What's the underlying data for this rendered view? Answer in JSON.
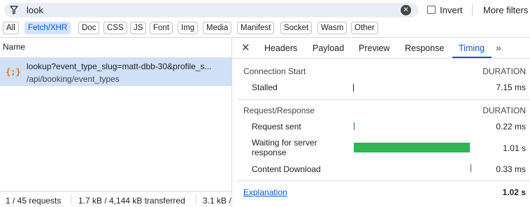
{
  "filter": {
    "query": "look",
    "invert_label": "Invert",
    "more_filters_label": "More filters"
  },
  "type_filters": [
    "All",
    "Fetch/XHR",
    "Doc",
    "CSS",
    "JS",
    "Font",
    "Img",
    "Media",
    "Manifest",
    "Socket",
    "Wasm",
    "Other"
  ],
  "type_filter_active": "Fetch/XHR",
  "requests": {
    "column_name": "Name",
    "items": [
      {
        "name": "lookup?event_type_slug=matt-dbb-30&profile_s...",
        "path": "/api/booking/event_types",
        "icon": "xhr-braces-icon"
      }
    ]
  },
  "status_bar": {
    "requests": "1 / 45 requests",
    "transferred": "1.7 kB / 4,144 kB transferred",
    "resources": "3.1 kB /"
  },
  "detail_tabs": [
    "Headers",
    "Payload",
    "Preview",
    "Response",
    "Timing"
  ],
  "active_tab": "Timing",
  "timing": {
    "connection_start": {
      "heading": "Connection Start",
      "duration_label": "DURATION",
      "rows": [
        {
          "label": "Stalled",
          "value": "7.15 ms",
          "share": 0.007
        }
      ]
    },
    "request_response": {
      "heading": "Request/Response",
      "duration_label": "DURATION",
      "rows": [
        {
          "label": "Request sent",
          "value": "0.22 ms",
          "share": 0.0002
        },
        {
          "label": "Waiting for server response",
          "value": "1.01 s",
          "share": 0.99
        },
        {
          "label": "Content Download",
          "value": "0.33 ms",
          "share": 0.0003
        }
      ]
    },
    "explanation_label": "Explanation",
    "total": "1.02 s"
  },
  "colors": {
    "accent": "#0b57d0",
    "selected_row": "#cfe0f7",
    "waiting_bar": "#30b552",
    "xhr_icon": "#e8710a"
  }
}
